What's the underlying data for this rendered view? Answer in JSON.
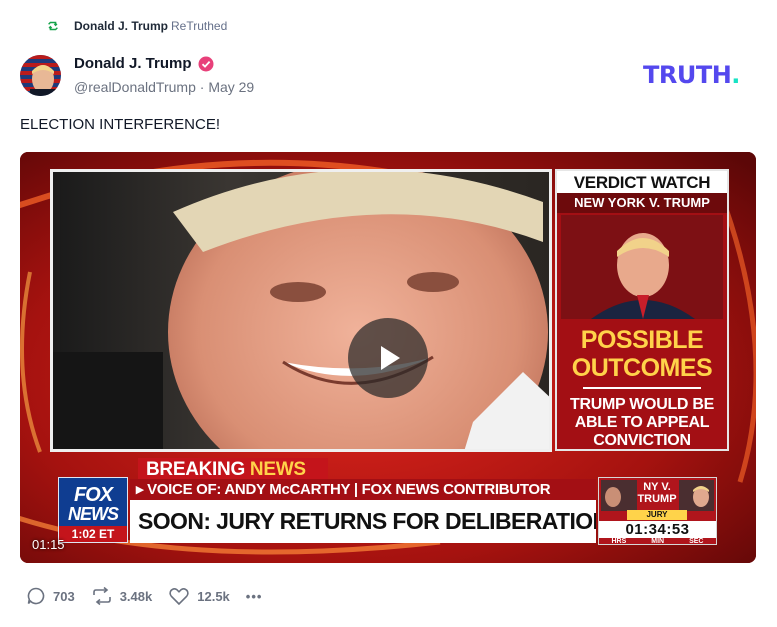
{
  "retruth": {
    "author": "Donald J. Trump",
    "label": "ReTruthed"
  },
  "post": {
    "author_name": "Donald J. Trump",
    "handle": "@realDonaldTrump",
    "separator": "·",
    "date": "May 29",
    "text": "ELECTION INTERFERENCE!"
  },
  "brand": {
    "logo_main": "TRUTH",
    "logo_dot": ".",
    "accent": "#5448ee",
    "dot_color": "#17e3c4"
  },
  "video": {
    "verdict_title": "VERDICT WATCH",
    "verdict_sub": "NEW YORK V. TRUMP",
    "outcomes_line1": "POSSIBLE",
    "outcomes_line2": "OUTCOMES",
    "outcomes_body": "TRUMP WOULD BE ABLE TO APPEAL CONVICTION",
    "breaking_word": "BREAKING",
    "breaking_news": "NEWS",
    "voice_line": "▸ VOICE OF: ANDY McCARTHY",
    "voice_sep": " | ",
    "voice_role": "FOX NEWS CONTRIBUTOR",
    "headline": "SOON: JURY RETURNS FOR DELIBERATIONS",
    "network_1": "FOX",
    "network_2": "NEWS",
    "network_time": "1:02 ET",
    "clock_label": "NY V. TRUMP",
    "clock_sub": "JURY DELIBERATION",
    "clock_time": "01:34:53",
    "clock_units": [
      "HRS",
      "MIN",
      "SEC"
    ],
    "duration": "01:15"
  },
  "actions": {
    "replies": "703",
    "retruths": "3.48k",
    "likes": "12.5k",
    "more": "•••"
  }
}
